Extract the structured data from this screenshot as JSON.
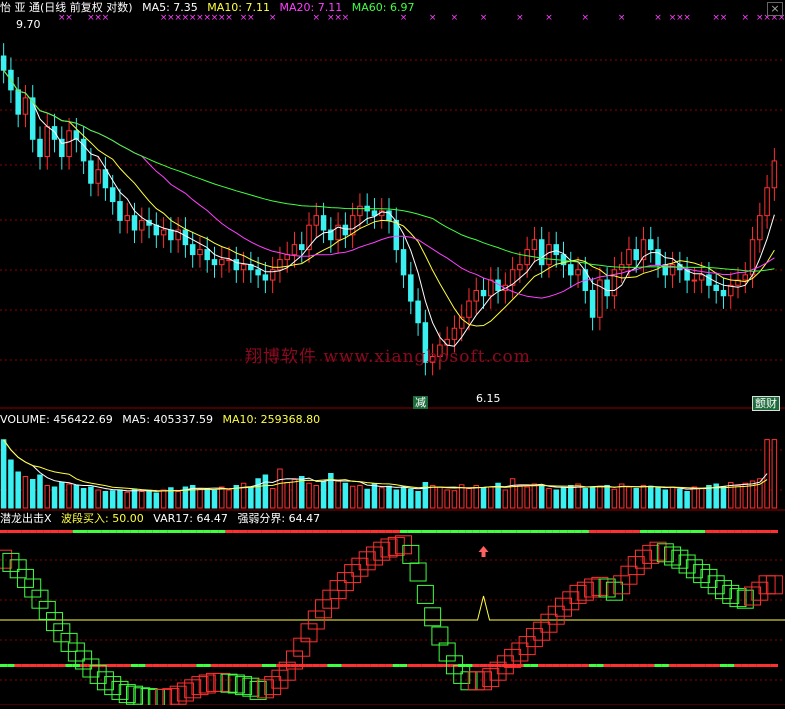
{
  "header": {
    "stock_title": "怡 亚 通(日线 前复权 对数)",
    "ma5": "MA5: 7.35",
    "ma10": "MA10: 7.11",
    "ma20": "MA20: 7.11",
    "ma60": "MA60: 6.97"
  },
  "volume_header": {
    "volume": "VOLUME: 456422.69",
    "ma5": "MA5: 405337.59",
    "ma10": "MA10: 259368.80"
  },
  "indicator_header": {
    "name": "潜龙出击X",
    "buy": "波段买入: 50.00",
    "var17": "VAR17: 64.47",
    "boundary": "强弱分界: 64.47"
  },
  "annotations": {
    "high_label": "9.70",
    "low_label": "6.15",
    "jian_tag": "减",
    "zhen_tag": "颤财",
    "watermark": "翔博软件 www.xiangbosoft.com",
    "close_glyph": "×"
  },
  "colors": {
    "up": "#ff3030",
    "down": "#3af0f0",
    "ma5": "#ffffff",
    "ma10": "#ffff40",
    "ma20": "#ff40ff",
    "ma60": "#40ff40",
    "indicator_green": "#40ff40",
    "indicator_red": "#ff3030",
    "grid": "#8b0000"
  },
  "chart_data": [
    {
      "type": "candlestick",
      "panel": "price",
      "y_scale": "log",
      "ylim": [
        5.9,
        10.0
      ],
      "x_count": 110,
      "close": [
        9.3,
        9.05,
        8.75,
        8.95,
        8.45,
        8.25,
        8.6,
        8.45,
        8.25,
        8.55,
        8.45,
        8.2,
        7.95,
        8.1,
        7.9,
        7.75,
        7.55,
        7.6,
        7.45,
        7.55,
        7.5,
        7.4,
        7.45,
        7.35,
        7.45,
        7.3,
        7.2,
        7.25,
        7.15,
        7.1,
        7.15,
        7.15,
        7.05,
        7.1,
        7.05,
        7.0,
        6.95,
        7.05,
        7.15,
        7.2,
        7.3,
        7.25,
        7.5,
        7.6,
        7.45,
        7.35,
        7.5,
        7.4,
        7.6,
        7.7,
        7.65,
        7.6,
        7.65,
        7.55,
        7.25,
        7.0,
        6.75,
        6.55,
        6.2,
        6.25,
        6.35,
        6.4,
        6.5,
        6.6,
        6.75,
        6.85,
        6.8,
        6.95,
        6.85,
        6.9,
        7.05,
        7.1,
        7.25,
        7.35,
        7.1,
        7.3,
        7.2,
        7.1,
        7.0,
        7.05,
        6.85,
        6.6,
        6.95,
        6.8,
        7.05,
        7.1,
        7.25,
        7.15,
        7.35,
        7.25,
        7.1,
        7.0,
        7.1,
        7.05,
        6.95,
        6.95,
        7.0,
        6.9,
        6.85,
        6.8,
        6.9,
        6.95,
        7.0,
        7.35,
        7.6,
        7.9,
        8.2
      ],
      "series": [
        {
          "name": "MA5",
          "value": 7.35
        },
        {
          "name": "MA10",
          "value": 7.11
        },
        {
          "name": "MA20",
          "value": 7.11
        },
        {
          "name": "MA60",
          "value": 6.97
        }
      ],
      "annotations": [
        {
          "label": "9.70",
          "x": 1,
          "y": 9.7
        },
        {
          "label": "6.15",
          "x": 59,
          "y": 6.15
        }
      ]
    },
    {
      "type": "bar",
      "panel": "volume",
      "ylim": [
        0,
        520000
      ],
      "values": [
        455000,
        320000,
        240000,
        210000,
        190000,
        220000,
        150000,
        140000,
        170000,
        160000,
        150000,
        130000,
        140000,
        120000,
        110000,
        115000,
        120000,
        105000,
        125000,
        110000,
        115000,
        100000,
        120000,
        135000,
        110000,
        140000,
        150000,
        125000,
        130000,
        118000,
        140000,
        120000,
        150000,
        165000,
        140000,
        195000,
        220000,
        130000,
        260000,
        170000,
        190000,
        210000,
        165000,
        150000,
        175000,
        230000,
        180000,
        165000,
        145000,
        150000,
        125000,
        160000,
        135000,
        145000,
        120000,
        140000,
        125000,
        110000,
        170000,
        150000,
        140000,
        120000,
        115000,
        155000,
        130000,
        150000,
        135000,
        140000,
        165000,
        120000,
        195000,
        150000,
        140000,
        160000,
        145000,
        130000,
        120000,
        135000,
        150000,
        160000,
        130000,
        140000,
        145000,
        150000,
        125000,
        160000,
        140000,
        130000,
        150000,
        145000,
        135000,
        120000,
        140000,
        125000,
        110000,
        140000,
        130000,
        150000,
        160000,
        140000,
        170000,
        150000,
        165000,
        180000,
        195000,
        456000
      ],
      "series": [
        {
          "name": "MA5",
          "value": 405337.59
        },
        {
          "name": "MA10",
          "value": 259368.8
        }
      ]
    },
    {
      "type": "line",
      "panel": "indicator",
      "ylim": [
        0,
        100
      ],
      "values": [
        88,
        86,
        82,
        76,
        70,
        63,
        56,
        49,
        42,
        36,
        30,
        25,
        20,
        16,
        12,
        9,
        6,
        4,
        3,
        2,
        1.5,
        1,
        1,
        1.5,
        3,
        5,
        7,
        9,
        10,
        11,
        11,
        10.5,
        10,
        9,
        8,
        6,
        7,
        9,
        13,
        18,
        25,
        33,
        42,
        50,
        57,
        63,
        69,
        74,
        79,
        83,
        87,
        90,
        93,
        95,
        96,
        97,
        91,
        80,
        66,
        52,
        40,
        30,
        22,
        16,
        12,
        12,
        12,
        14,
        18,
        22,
        26,
        30,
        34,
        39,
        43,
        48,
        53,
        58,
        62,
        66,
        68,
        70,
        71,
        70,
        68,
        72,
        78,
        84,
        88,
        91,
        93,
        92,
        90,
        88,
        85,
        82,
        79,
        76,
        72,
        69,
        66,
        64,
        63,
        65,
        68,
        72
      ],
      "series": [
        {
          "name": "波段买入",
          "value": 50.0
        },
        {
          "name": "VAR17",
          "value": 64.47
        },
        {
          "name": "强弱分界",
          "value": 64.47
        }
      ],
      "annotations": [
        {
          "label": "buy-arrow",
          "x": 66
        }
      ]
    }
  ]
}
